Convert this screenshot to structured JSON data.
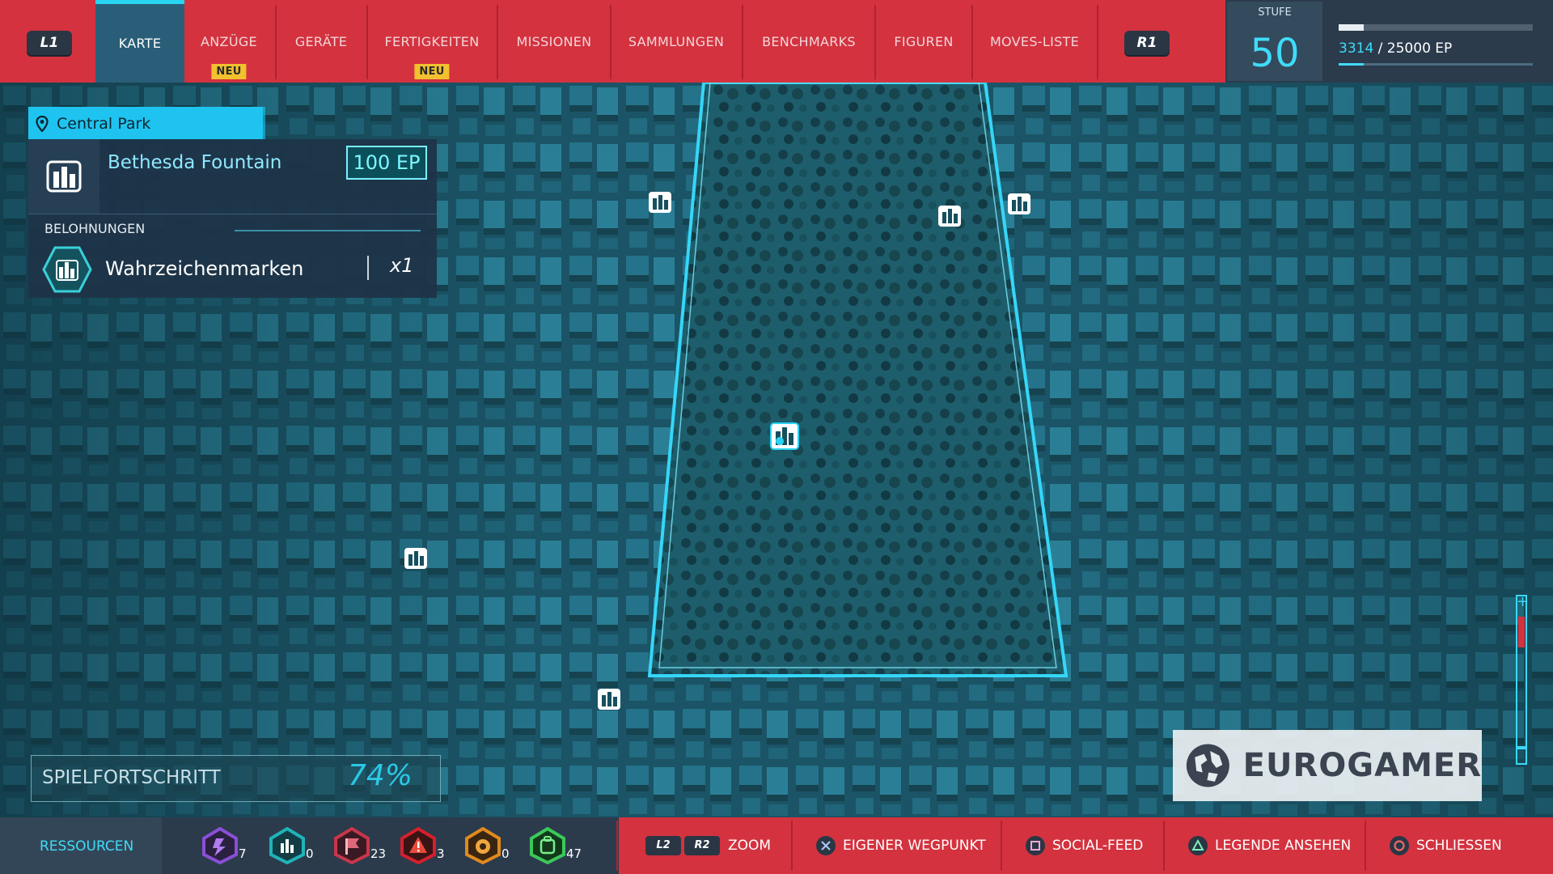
{
  "tabs": [
    {
      "label": "KARTE",
      "active": true,
      "badge": ""
    },
    {
      "label": "ANZÜGE",
      "active": false,
      "badge": "NEU"
    },
    {
      "label": "GERÄTE",
      "active": false,
      "badge": ""
    },
    {
      "label": "FERTIGKEITEN",
      "active": false,
      "badge": "NEU"
    },
    {
      "label": "MISSIONEN",
      "active": false,
      "badge": ""
    },
    {
      "label": "SAMMLUNGEN",
      "active": false,
      "badge": ""
    },
    {
      "label": "BENCHMARKS",
      "active": false,
      "badge": ""
    },
    {
      "label": "FIGUREN",
      "active": false,
      "badge": ""
    },
    {
      "label": "MOVES-LISTE",
      "active": false,
      "badge": ""
    }
  ],
  "bumpers": {
    "left": "L1",
    "right": "R1"
  },
  "level": {
    "stufe_label": "STUFE",
    "value": "50",
    "ep_current": "3314",
    "ep_rest": " / 25000 EP",
    "ep_progress": 0.13
  },
  "info": {
    "district": "Central Park",
    "landmark": "Bethesda Fountain",
    "ep_reward": "100 EP",
    "rewards_label": "BELOHNUNGEN",
    "reward_name": "Wahrzeichenmarken",
    "reward_count": "x1"
  },
  "progress": {
    "label": "SPIELFORTSCHRITT",
    "value": "74%"
  },
  "resources": {
    "label": "RESSOURCEN",
    "items": [
      {
        "icon": "research-token-icon",
        "count": "7",
        "color": "#8a4fd6"
      },
      {
        "icon": "landmark-token-icon",
        "count": "0",
        "color": "#1fb3b8"
      },
      {
        "icon": "crime-token-icon",
        "count": "23",
        "color": "#c8364a"
      },
      {
        "icon": "challenge-token-icon",
        "count": "3",
        "color": "#d4202c"
      },
      {
        "icon": "base-token-icon",
        "count": "0",
        "color": "#e08a1e"
      },
      {
        "icon": "backpack-token-icon",
        "count": "47",
        "color": "#3cc85a"
      }
    ]
  },
  "hints": [
    {
      "buttons": [
        "L2",
        "R2"
      ],
      "label": "ZOOM"
    },
    {
      "icon": "cross-button-icon",
      "label": "EIGENER WEGPUNKT"
    },
    {
      "icon": "square-button-icon",
      "label": "SOCIAL-FEED"
    },
    {
      "icon": "triangle-button-icon",
      "label": "LEGENDE ANSEHEN"
    },
    {
      "icon": "circle-button-icon",
      "label": "SCHLIESSEN"
    }
  ],
  "watermark": "EUROGAMER",
  "zoom_level": 0.85,
  "colors": {
    "accent": "#29d3f2",
    "bar_red": "#d4323f",
    "panel": "#1e3448",
    "map": "#1d5a6a"
  }
}
